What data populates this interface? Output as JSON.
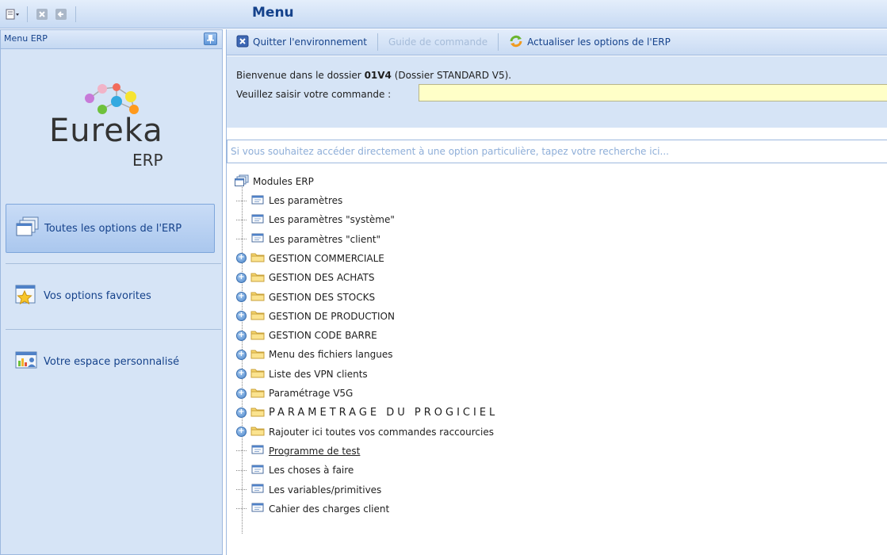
{
  "window": {
    "title": "Menu"
  },
  "quick_access": [
    {
      "icon": "app-menu-icon"
    },
    {
      "icon": "close-window-icon"
    },
    {
      "icon": "back-icon"
    }
  ],
  "sidebar": {
    "header": "Menu ERP",
    "pin_icon": "pin-icon",
    "logo": {
      "text": "Eureka",
      "sub": "ERP"
    },
    "items": [
      {
        "label": "Toutes les options de l'ERP",
        "icon": "all-options-icon",
        "active": true
      },
      {
        "label": "Vos options favorites",
        "icon": "favorites-star-icon",
        "active": false
      },
      {
        "label": "Votre espace personnalisé",
        "icon": "personal-space-icon",
        "active": false
      }
    ]
  },
  "toolbar": {
    "quit_label": "Quitter l'environnement",
    "guide_label": "Guide de commande",
    "refresh_label": "Actualiser les options de l'ERP"
  },
  "welcome": {
    "prefix": "Bienvenue dans le dossier ",
    "folder_code": "01V4",
    "suffix": " (Dossier STANDARD V5).",
    "command_label": "Veuillez saisir votre commande :",
    "command_value": ""
  },
  "search": {
    "placeholder": "Si vous souhaitez accéder directement à une option particulière, tapez votre recherche ici..."
  },
  "tree": {
    "root": "Modules ERP",
    "items": [
      {
        "label": "Les paramètres",
        "type": "option"
      },
      {
        "label": "Les paramètres \"système\"",
        "type": "option"
      },
      {
        "label": "Les paramètres \"client\"",
        "type": "option"
      },
      {
        "label": "GESTION COMMERCIALE",
        "type": "folder"
      },
      {
        "label": "GESTION DES ACHATS",
        "type": "folder"
      },
      {
        "label": "GESTION DES STOCKS",
        "type": "folder"
      },
      {
        "label": "GESTION DE PRODUCTION",
        "type": "folder"
      },
      {
        "label": "GESTION CODE BARRE",
        "type": "folder"
      },
      {
        "label": "Menu des fichiers langues",
        "type": "folder"
      },
      {
        "label": "Liste des VPN clients",
        "type": "folder"
      },
      {
        "label": "Paramétrage V5G",
        "type": "folder"
      },
      {
        "label": "PARAMETRAGE DU PROGICIEL",
        "type": "folder"
      },
      {
        "label": "Rajouter ici toutes vos commandes raccourcies",
        "type": "folder"
      },
      {
        "label": "Programme de test",
        "type": "option"
      },
      {
        "label": "Les choses à faire",
        "type": "option"
      },
      {
        "label": "Les variables/primitives",
        "type": "option"
      },
      {
        "label": "Cahier des charges client",
        "type": "option"
      }
    ]
  },
  "colors": {
    "title_text": "#15428b",
    "panel_bg": "#d6e4f6",
    "command_input_bg": "#ffffc8",
    "disabled_text": "#a6bcd9"
  }
}
